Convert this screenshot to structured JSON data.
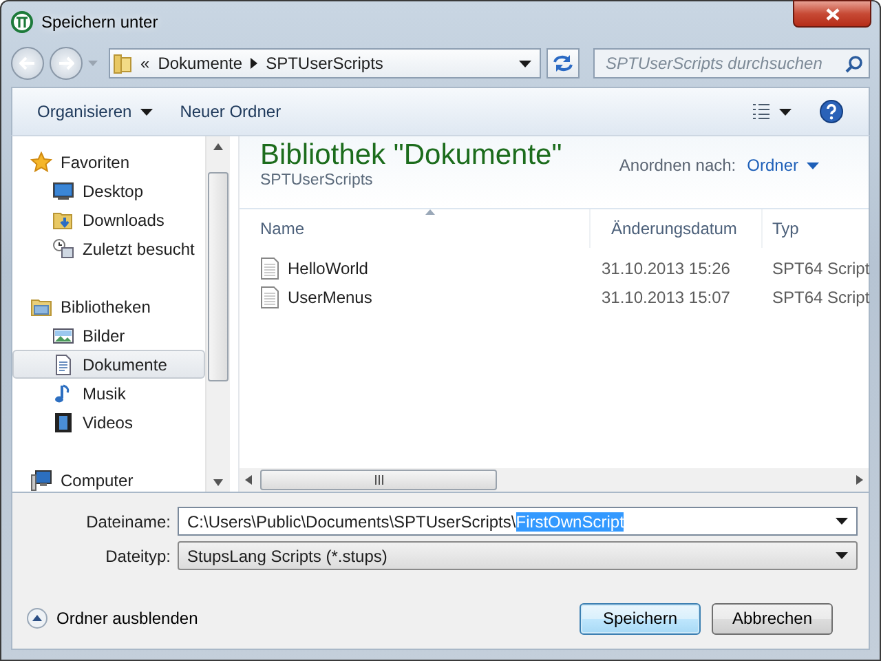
{
  "window": {
    "title": "Speichern unter"
  },
  "address": {
    "overflow": "«",
    "crumbs": [
      "Dokumente",
      "SPTUserScripts"
    ]
  },
  "search": {
    "placeholder": "SPTUserScripts durchsuchen"
  },
  "toolbar": {
    "organize": "Organisieren",
    "new_folder": "Neuer Ordner"
  },
  "sidebar": {
    "groups": [
      {
        "label": "Favoriten",
        "kind": "star",
        "selected": false,
        "children": [
          {
            "label": "Desktop",
            "kind": "desktop",
            "selected": false
          },
          {
            "label": "Downloads",
            "kind": "downloads",
            "selected": false
          },
          {
            "label": "Zuletzt besucht",
            "kind": "recent",
            "selected": false
          }
        ]
      },
      {
        "label": "Bibliotheken",
        "kind": "libraries",
        "selected": false,
        "children": [
          {
            "label": "Bilder",
            "kind": "pictures",
            "selected": false
          },
          {
            "label": "Dokumente",
            "kind": "documents",
            "selected": true
          },
          {
            "label": "Musik",
            "kind": "music",
            "selected": false
          },
          {
            "label": "Videos",
            "kind": "videos",
            "selected": false
          }
        ]
      },
      {
        "label": "Computer",
        "kind": "computer",
        "selected": false
      }
    ]
  },
  "library": {
    "title": "Bibliothek \"Dokumente\"",
    "subtitle": "SPTUserScripts",
    "arrange_label": "Anordnen nach:",
    "arrange_value": "Ordner"
  },
  "table": {
    "columns": [
      "Name",
      "Änderungsdatum",
      "Typ"
    ],
    "rows": [
      {
        "name": "HelloWorld",
        "date": "31.10.2013 15:26",
        "type": "SPT64 Script"
      },
      {
        "name": "UserMenus",
        "date": "31.10.2013 15:07",
        "type": "SPT64 Script"
      }
    ]
  },
  "form": {
    "filename_label": "Dateiname:",
    "filename_value": "C:\\Users\\Public\\Documents\\SPTUserScripts\\",
    "filename_selection": "FirstOwnScript",
    "filetype_label": "Dateityp:",
    "filetype_value": "StupsLang Scripts (*.stups)"
  },
  "hide_folders": "Ordner ausblenden",
  "buttons": [
    {
      "label": "Speichern",
      "default": true
    },
    {
      "label": "Abbrechen",
      "default": false
    }
  ]
}
